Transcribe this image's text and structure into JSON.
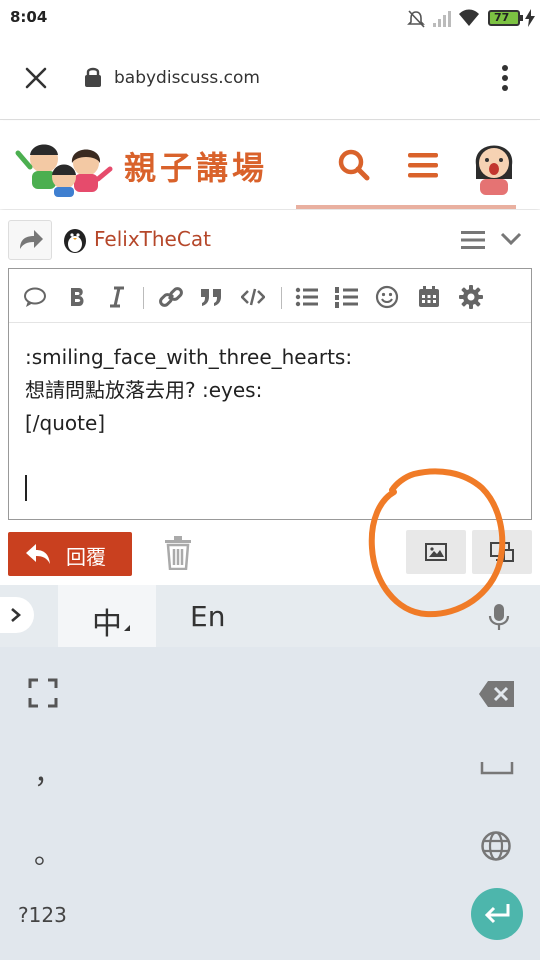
{
  "status_bar": {
    "time": "8:04",
    "battery": "77"
  },
  "browser": {
    "url": "babydiscuss.com",
    "icons": [
      "close-icon",
      "lock-icon",
      "more-vert-icon"
    ]
  },
  "site": {
    "title": "親子講場",
    "accent": "#d9622b"
  },
  "reply_bar": {
    "username": "FelixTheCat"
  },
  "editor": {
    "lines": [
      ":smiling_face_with_three_hearts:",
      "想請問點放落去用? :eyes:",
      "[/quote]"
    ]
  },
  "actions": {
    "reply_label": "回覆",
    "reply_color": "#c9401f"
  },
  "keyboard": {
    "mode_zh": "中",
    "mode_en": "En",
    "comma": "，",
    "period": "。",
    "numbers_key": "?123",
    "enter_color": "#4db6ac"
  },
  "annotation_color": "#f07b27"
}
